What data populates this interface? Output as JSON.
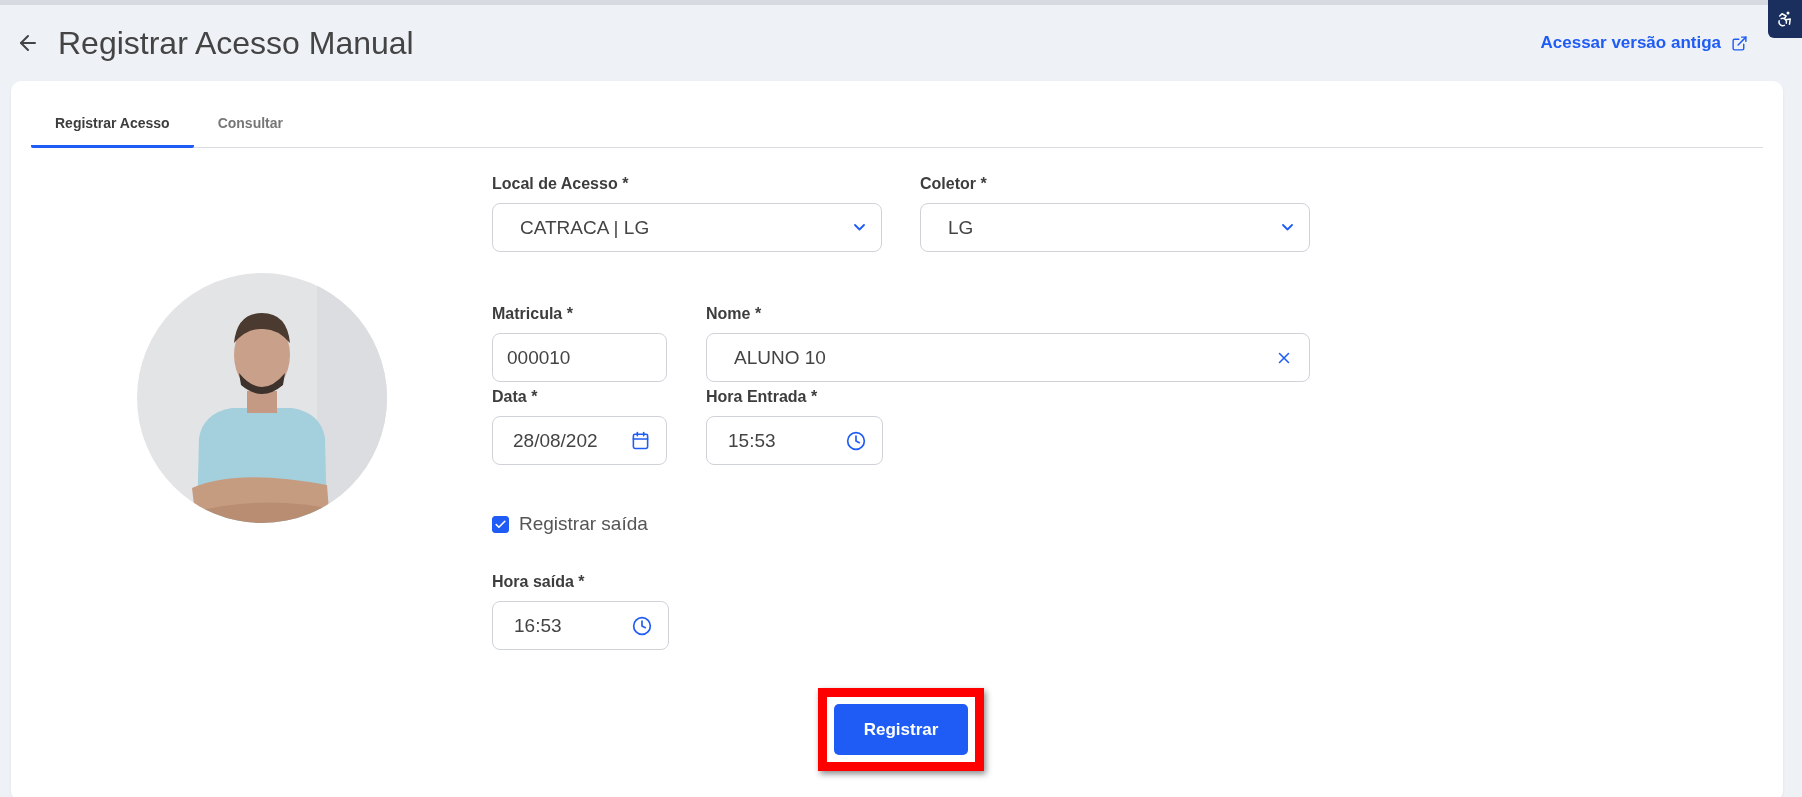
{
  "header": {
    "title": "Registrar Acesso Manual",
    "link": "Acessar versão antiga"
  },
  "tabs": [
    {
      "label": "Registrar Acesso",
      "selected": true
    },
    {
      "label": "Consultar",
      "selected": false
    }
  ],
  "rows": [
    [
      {
        "kind": "select",
        "label": "Local de Acesso *",
        "value": "CATRACA | LG"
      },
      {
        "kind": "select",
        "label": "Coletor *",
        "value": "LG"
      }
    ],
    [
      {
        "kind": "text",
        "label": "Matricula *",
        "value": "000010"
      },
      {
        "kind": "clearable",
        "label": "Nome *",
        "value": "ALUNO 10"
      }
    ],
    [
      {
        "kind": "date",
        "label": "Data *",
        "value": "28/08/202"
      },
      {
        "kind": "time",
        "label": "Hora Entrada *",
        "value": "15:53"
      }
    ]
  ],
  "exit": {
    "label": "Registrar saída",
    "checked": true
  },
  "exit_field": {
    "kind": "time",
    "label": "Hora saída *",
    "value": "16:53"
  },
  "submit": {
    "label": "Registrar"
  }
}
